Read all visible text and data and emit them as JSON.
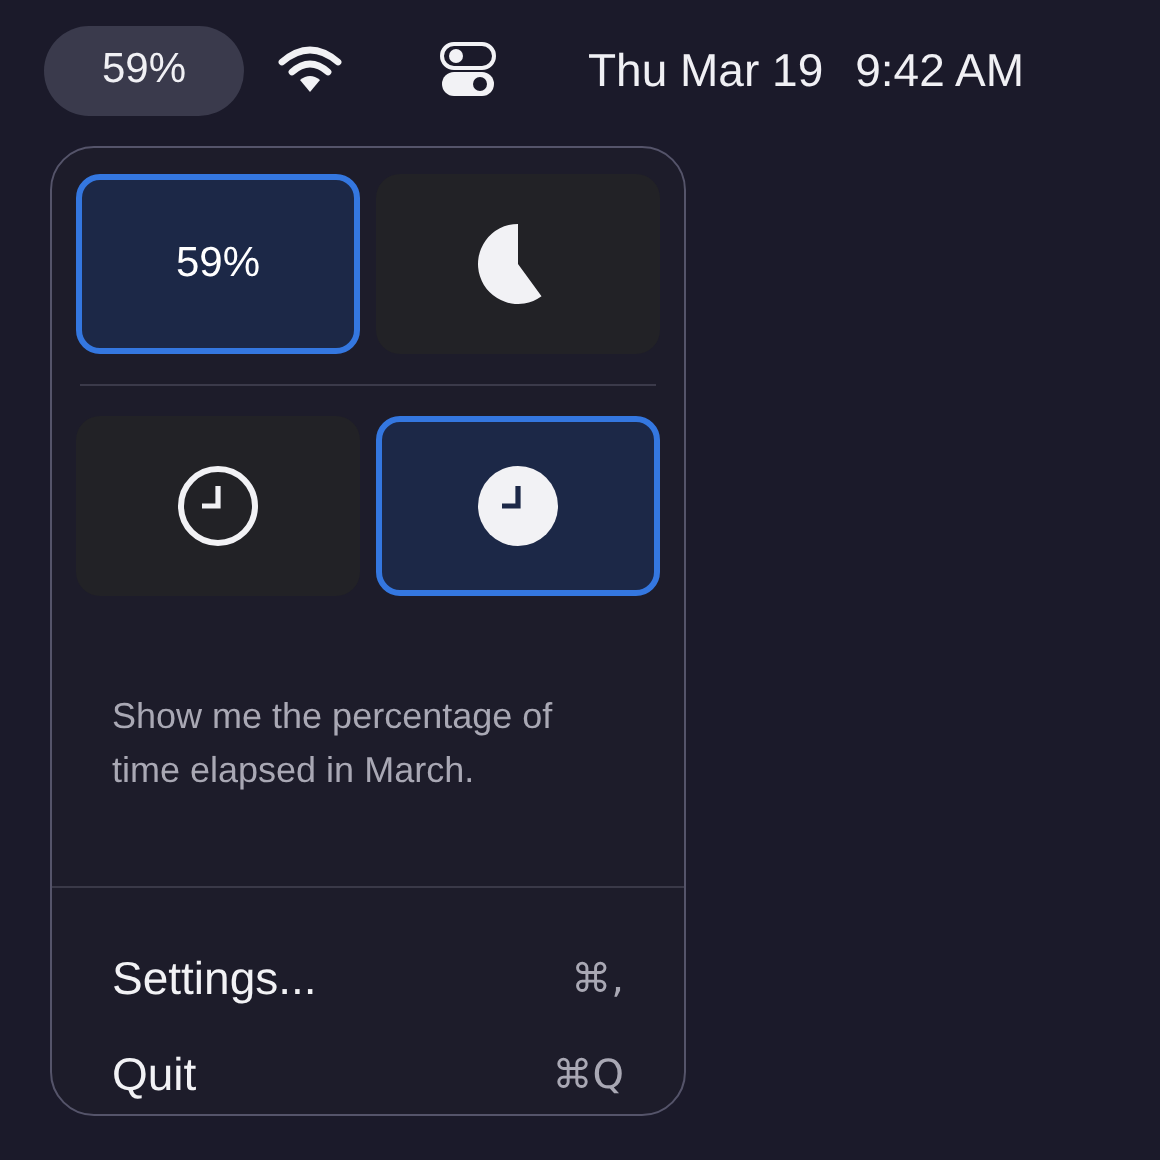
{
  "menu_bar": {
    "percent": "59%",
    "date": "Thu Mar 19",
    "time": "9:42 AM"
  },
  "popup": {
    "style_rows": [
      [
        {
          "kind": "text",
          "label": "59%",
          "selected": true
        },
        {
          "kind": "pie",
          "selected": false
        }
      ],
      [
        {
          "kind": "clock-outline",
          "selected": false
        },
        {
          "kind": "clock-filled",
          "selected": true
        }
      ]
    ],
    "description": "Show me the percentage of time elapsed in March.",
    "menu_items": [
      {
        "label": "Settings...",
        "shortcut": "⌘,"
      },
      {
        "label": "Quit",
        "shortcut": "⌘Q"
      }
    ]
  }
}
